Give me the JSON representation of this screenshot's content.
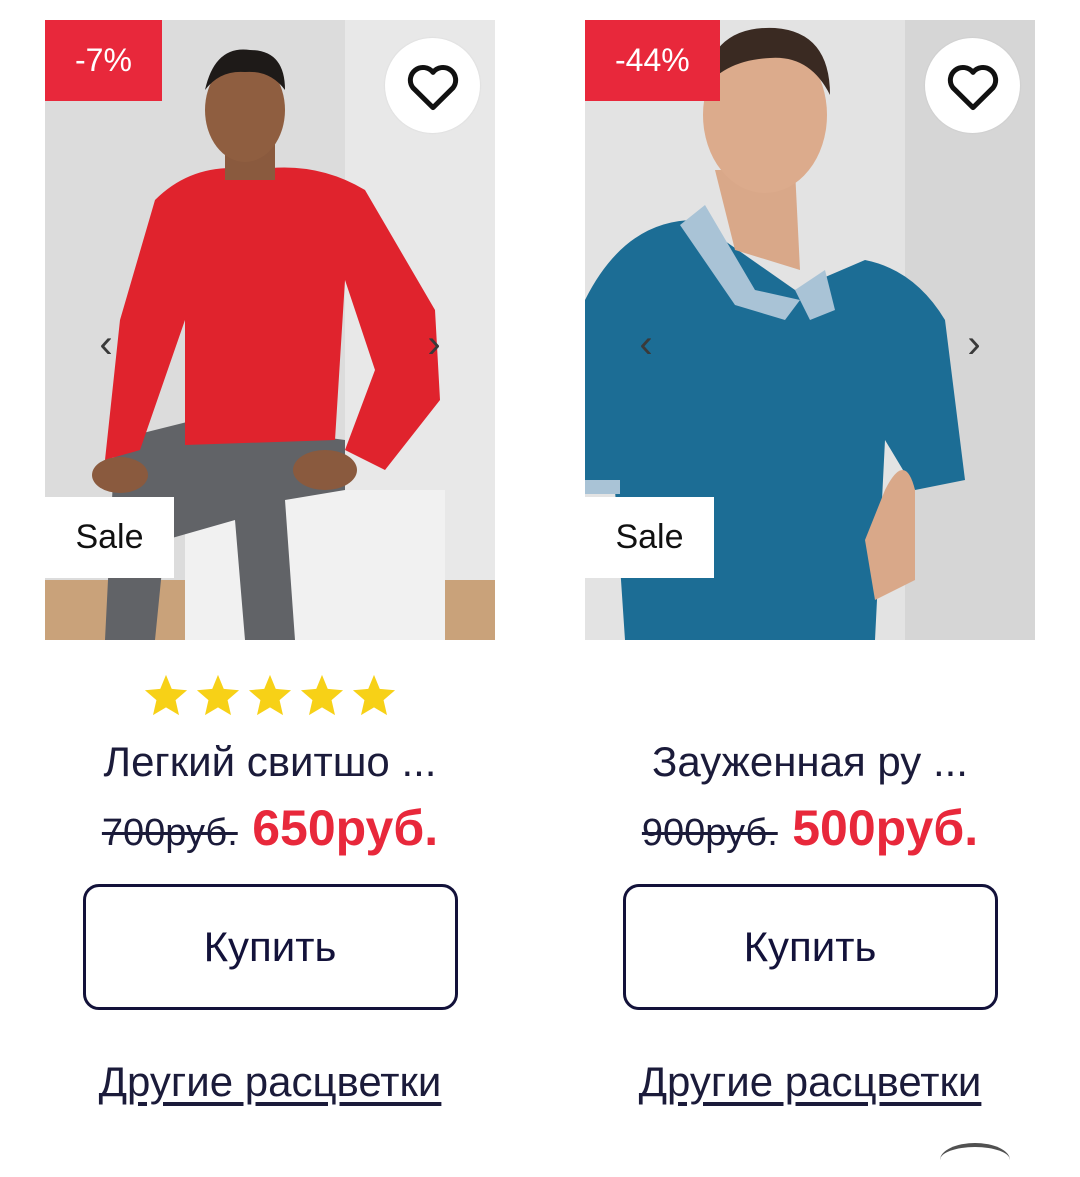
{
  "products": [
    {
      "discount": "-7%",
      "badge": "Sale",
      "rating": 5,
      "rating_max": 5,
      "title": "Легкий свитшо ...",
      "old_price": "700руб.",
      "new_price": "650руб.",
      "buy_label": "Купить",
      "colors_link": "Другие расцветки",
      "prev_arrow": "‹",
      "next_arrow": "›",
      "icons": {
        "favorite": "heart-icon"
      }
    },
    {
      "discount": "-44%",
      "badge": "Sale",
      "rating": 0,
      "rating_max": 5,
      "title": "Зауженная ру ...",
      "old_price": "900руб.",
      "new_price": "500руб.",
      "buy_label": "Купить",
      "colors_link": "Другие расцветки",
      "prev_arrow": "‹",
      "next_arrow": "›",
      "icons": {
        "favorite": "heart-icon"
      }
    }
  ],
  "colors": {
    "accent_red": "#e8283b",
    "text_navy": "#1b1b3a",
    "star": "#f7d117"
  }
}
